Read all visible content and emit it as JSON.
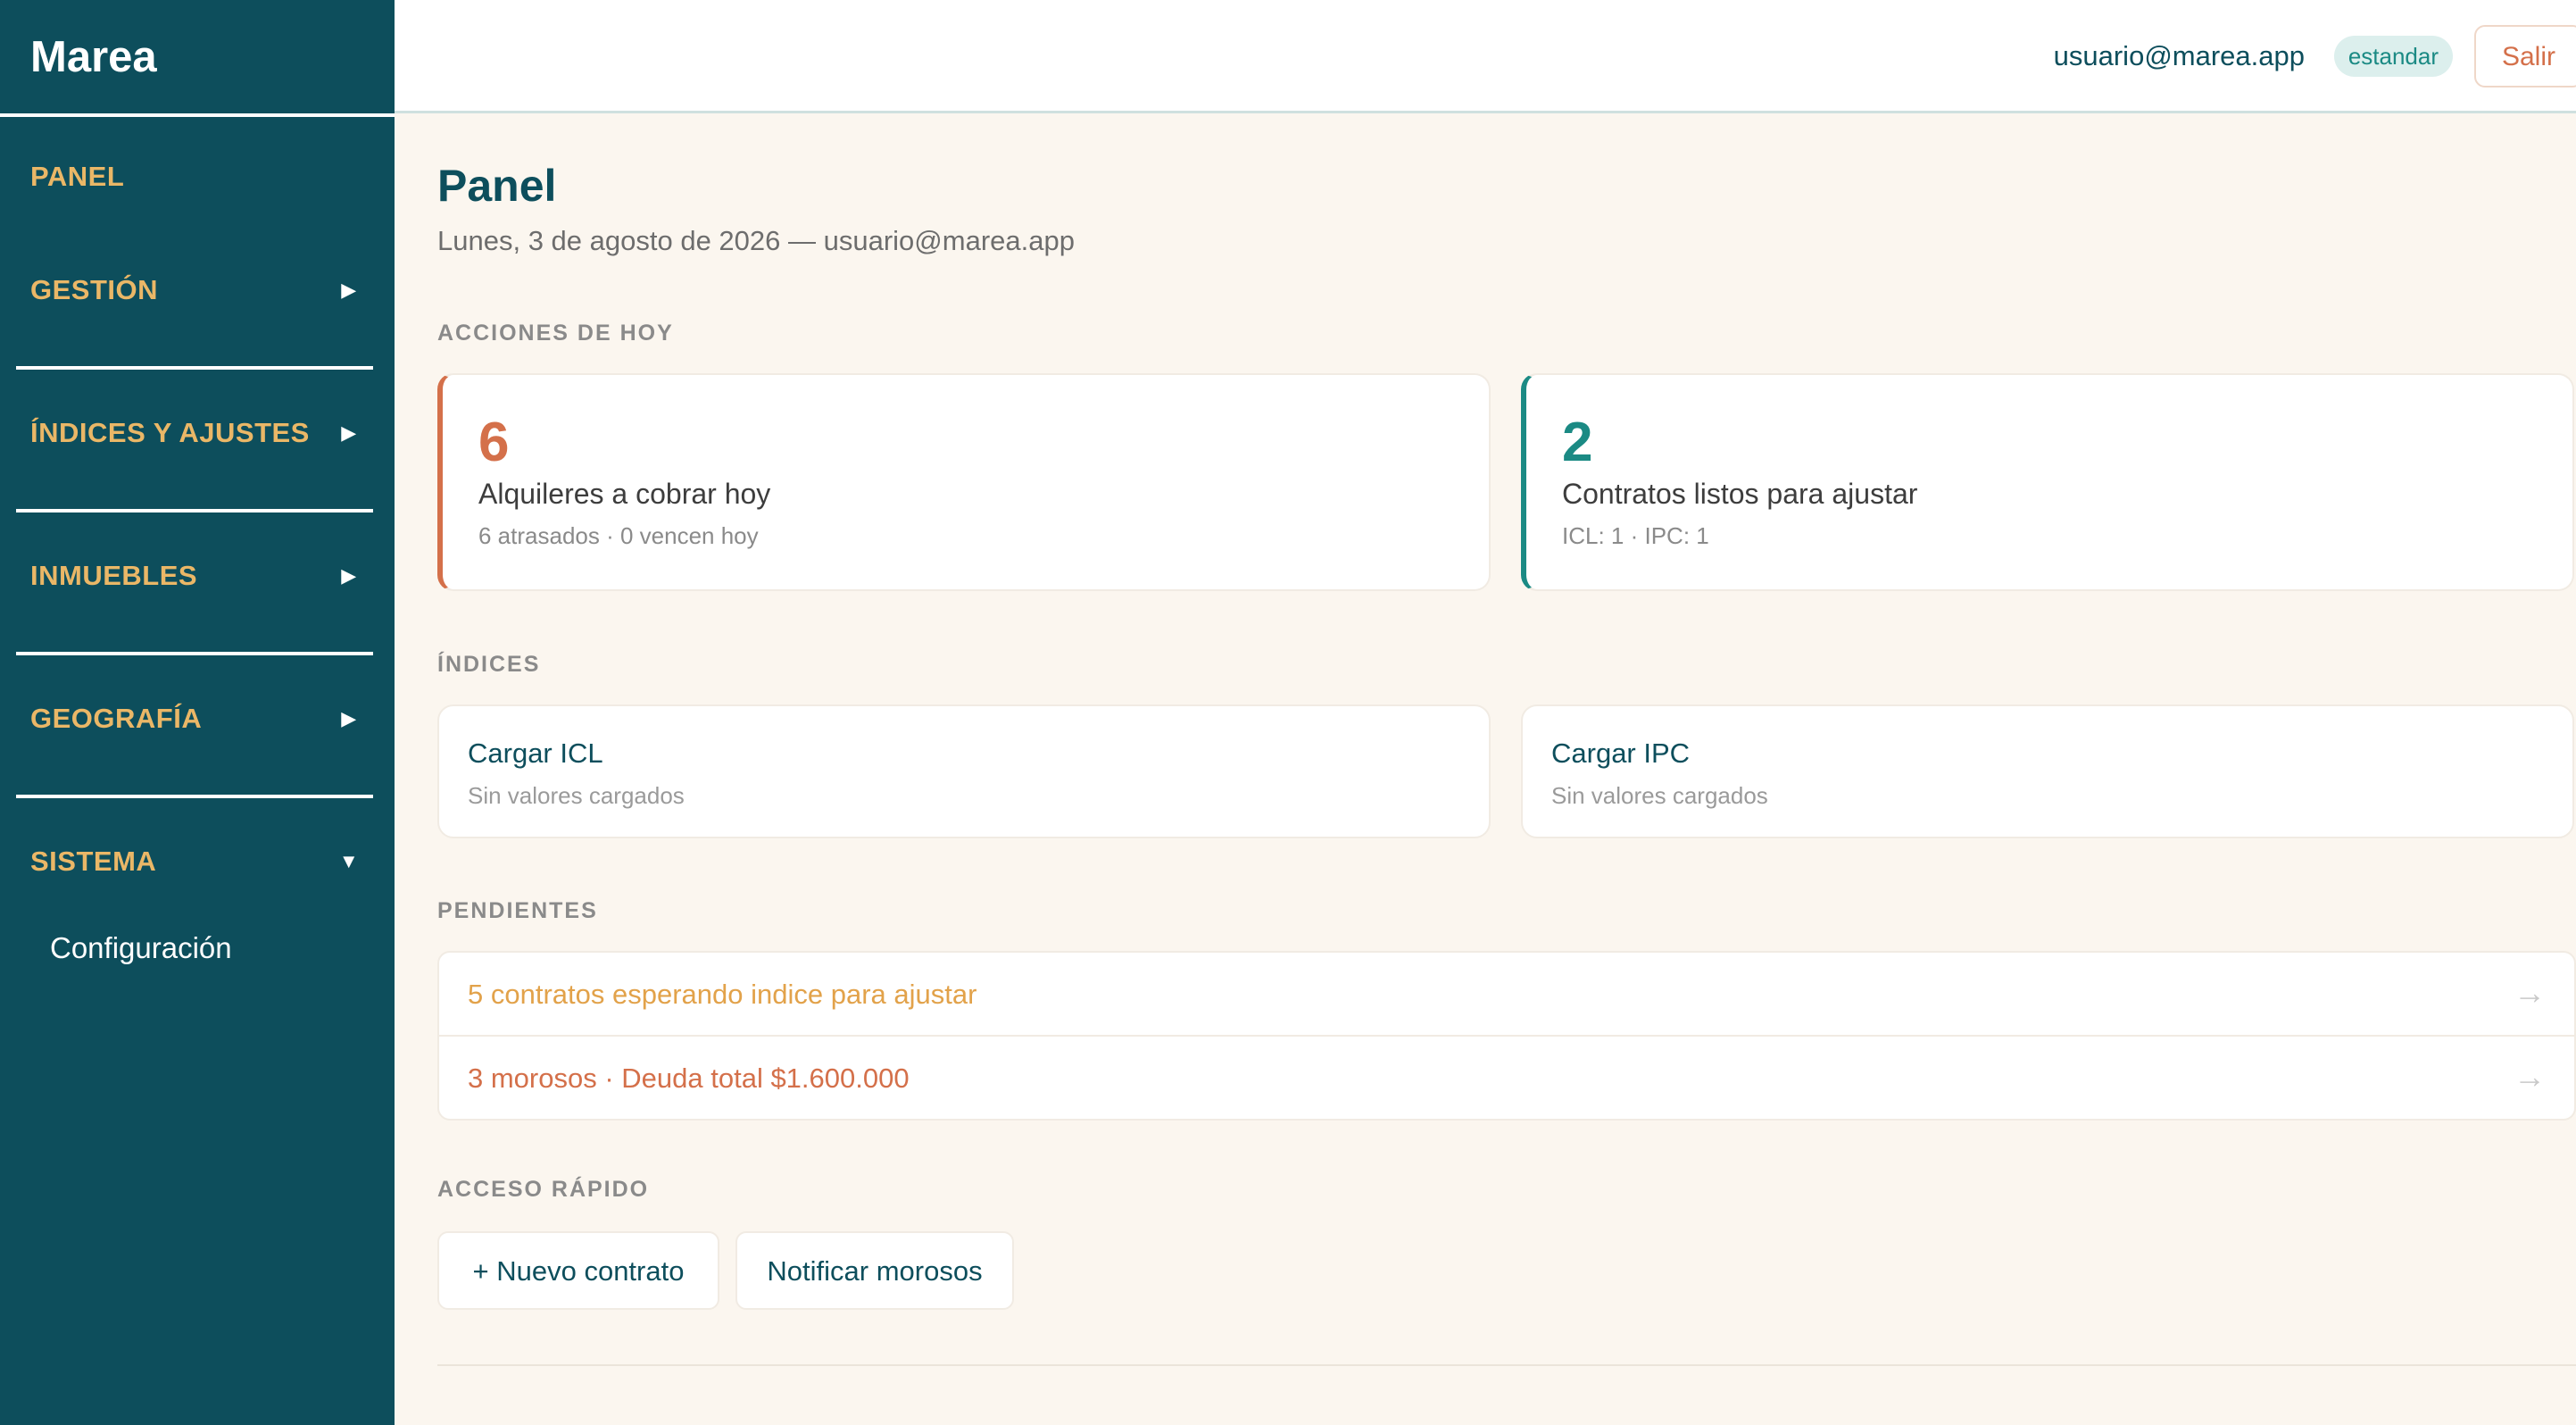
{
  "app": {
    "brand": "Marea"
  },
  "sidebar": {
    "items": [
      {
        "label": "PANEL",
        "chevron": ""
      },
      {
        "label": "GESTIÓN",
        "chevron": "▶"
      },
      {
        "label": "ÍNDICES Y AJUSTES",
        "chevron": "▶"
      },
      {
        "label": "INMUEBLES",
        "chevron": "▶"
      },
      {
        "label": "GEOGRAFÍA",
        "chevron": "▶"
      },
      {
        "label": "SISTEMA",
        "chevron": "▼"
      }
    ],
    "subitems": [
      {
        "label": "Configuración"
      }
    ]
  },
  "topbar": {
    "user_email": "usuario@marea.app",
    "role": "estandar",
    "logout_label": "Salir"
  },
  "main": {
    "title": "Panel",
    "subtitle": "Lunes, 3 de agosto de 2026 — usuario@marea.app",
    "today": {
      "heading": "ACCIONES DE HOY",
      "cards": [
        {
          "value": "6",
          "title": "Alquileres a cobrar hoy",
          "detail": "6 atrasados · 0 vencen hoy"
        },
        {
          "value": "2",
          "title": "Contratos listos para ajustar",
          "detail": "ICL: 1 · IPC: 1"
        }
      ]
    },
    "indices": {
      "heading": "ÍNDICES",
      "cards": [
        {
          "title": "Cargar ICL",
          "detail": "Sin valores cargados"
        },
        {
          "title": "Cargar IPC",
          "detail": "Sin valores cargados"
        }
      ]
    },
    "pending": {
      "heading": "PENDIENTES",
      "rows": [
        {
          "text": "5 contratos esperando indice para ajustar",
          "arrow": "→"
        },
        {
          "text": "3 morosos · Deuda total $1.600.000",
          "arrow": "→"
        }
      ]
    },
    "quick": {
      "heading": "ACCESO RÁPIDO",
      "buttons": [
        {
          "label": "+ Nuevo contrato"
        },
        {
          "label": "Notificar morosos"
        }
      ]
    }
  },
  "colors": {
    "sidebar_bg": "#0d4e5c",
    "nav_text": "#eab767",
    "accent_red": "#d4704a",
    "accent_teal": "#1b8a84",
    "warning": "#e2a24a",
    "page_bg": "#fbf6ef"
  }
}
